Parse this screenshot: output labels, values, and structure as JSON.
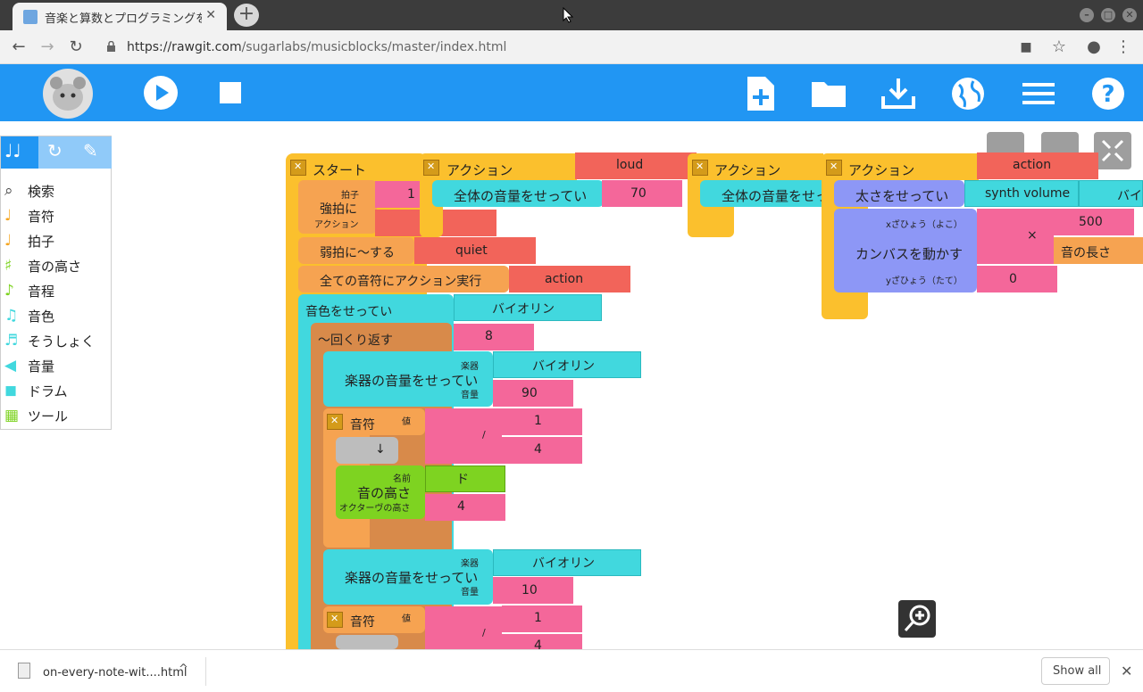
{
  "browser": {
    "tab_title": "音楽と算数とプログラミングを学",
    "url_host": "https://rawgit.com",
    "url_path": "/sugarlabs/musicblocks/master/index.html"
  },
  "palette": {
    "items": [
      {
        "label": "検索",
        "icon": "search-icon"
      },
      {
        "label": "音符",
        "icon": "notes-icon"
      },
      {
        "label": "拍子",
        "icon": "meter-icon"
      },
      {
        "label": "音の高さ",
        "icon": "pitch-icon"
      },
      {
        "label": "音程",
        "icon": "interval-icon"
      },
      {
        "label": "音色",
        "icon": "tone-icon"
      },
      {
        "label": "そうしょく",
        "icon": "ornament-icon"
      },
      {
        "label": "音量",
        "icon": "volume-icon"
      },
      {
        "label": "ドラム",
        "icon": "drum-icon"
      },
      {
        "label": "ツール",
        "icon": "widgets-icon"
      }
    ]
  },
  "blocks": {
    "start_label": "スタート",
    "beat_label": "拍子",
    "beat_value": "1",
    "strong_label": "強拍に",
    "action_sub": "アクション",
    "weak_label": "弱拍に～する",
    "quiet_value": "quiet",
    "every_note_label": "全ての音符にアクション実行",
    "action_value": "action",
    "set_timbre_label": "音色をせってい",
    "violin": "バイオリン",
    "repeat_label": "～回くり返す",
    "repeat_value": "8",
    "instr_vol_label": "楽器の音量をせってい",
    "instrument_sub": "楽器",
    "volume_sub": "音量",
    "vol_value_1": "90",
    "vol_value_2": "10",
    "note_label": "音符",
    "value_sub": "値",
    "div_symbol": "/",
    "num_1": "1",
    "num_4": "4",
    "rest_symbol": "↓",
    "name_sub": "名前",
    "pitch_label": "音の高さ",
    "octave_sub": "オクターヴの高さ",
    "pitch_do": "ド",
    "octave_value": "4",
    "action_header": "アクション",
    "loud_value": "loud",
    "master_vol_label": "全体の音量をせってい",
    "master_vol_label_cut": "全体の音量をせっ",
    "master_vol_value": "70",
    "action3_value": "action",
    "set_param_label": "太さをせってい",
    "synth_volume": "synth volume",
    "violin_cut": "バイ",
    "move_canvas_label": "カンバスを動かす",
    "x_sub": "xざひょう（よこ）",
    "y_sub": "yざひょう（たて）",
    "times_symbol": "×",
    "value_500": "500",
    "note_length": "音の長さ",
    "y_value": "0"
  },
  "download": {
    "file_name": "on-every-note-wit....html",
    "show_all": "Show all"
  }
}
